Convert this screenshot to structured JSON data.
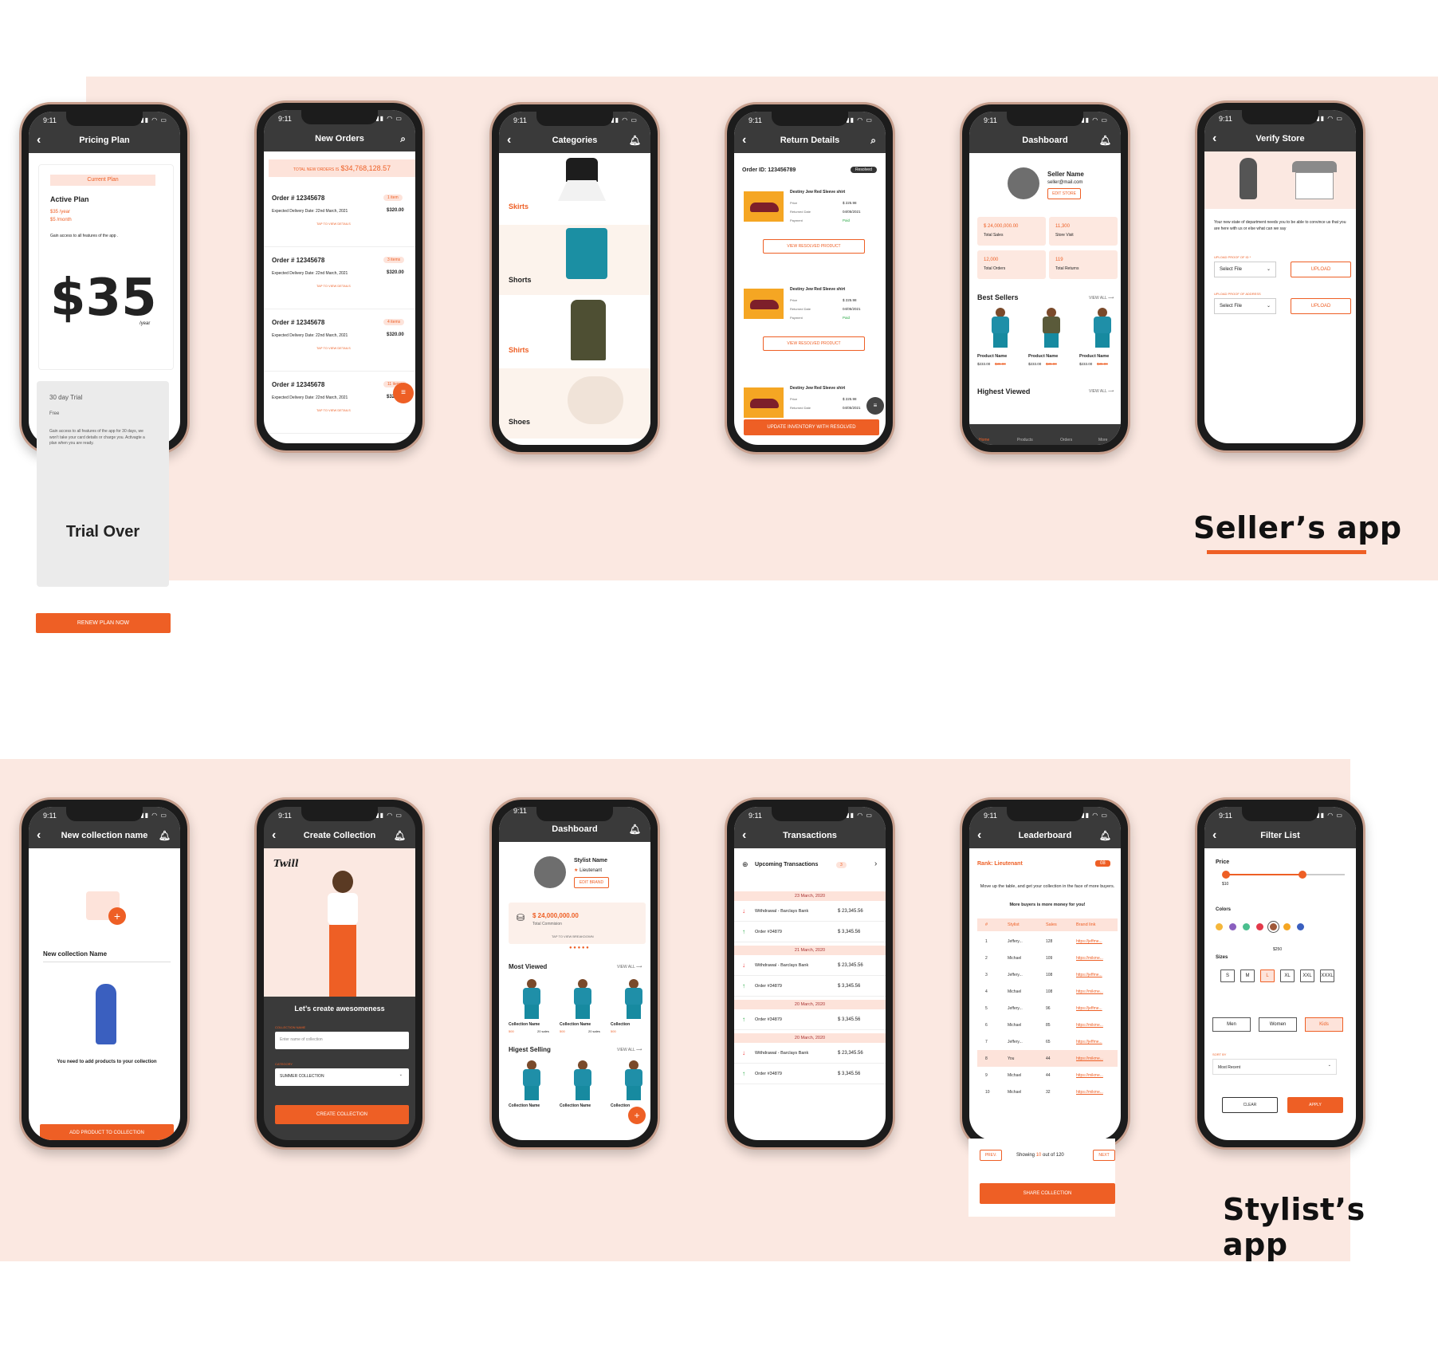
{
  "sections": {
    "seller": "Seller’s app",
    "stylist": "Stylist’s app"
  },
  "status": {
    "time": "9:11",
    "signal": "▮▮ ◠ ▭"
  },
  "colors": {
    "accent": "#ee5f25",
    "band": "#fbe8e1",
    "header": "#3a3a3a"
  },
  "pricing": {
    "title": "Pricing Plan",
    "current": "Current Plan",
    "active": "Active Plan",
    "year": "$35 /year",
    "month": "$5 /month",
    "gain": "Gain access to all features of the app .",
    "price": "$35",
    "per": "/year",
    "trial_title": "30 day Trial",
    "free": "Free",
    "trial_desc": "Gain access to all features of the app for 30 days, we won’t take your card details or charge you. Activagte a plan when you are ready.",
    "trial_over": "Trial Over",
    "renew": "RENEW PLAN NOW"
  },
  "orders": {
    "title": "New Orders",
    "total_label": "TOTAL NEW ORDERS IS",
    "total": "$34,768,128.57",
    "items": [
      {
        "id": "Order # 12345678",
        "badge": "1 item",
        "date": "Expected Delivery Date: 22nd March, 2021",
        "amount": "$320.00",
        "tap": "TAP TO VIEW DETAILS"
      },
      {
        "id": "Order # 12345678",
        "badge": "3 items",
        "date": "Expected Delivery Date: 22nd March, 2021",
        "amount": "$320.00",
        "tap": "TAP TO VIEW DETAILS"
      },
      {
        "id": "Order # 12345678",
        "badge": "4 items",
        "date": "Expected Delivery Date: 22nd March, 2021",
        "amount": "$320.00",
        "tap": "TAP TO VIEW DETAILS"
      },
      {
        "id": "Order # 12345678",
        "badge": "11 items",
        "date": "Expected Delivery Date: 22nd March, 2021",
        "amount": "$320.00",
        "tap": "TAP TO VIEW DETAILS"
      }
    ]
  },
  "categories": {
    "title": "Categories",
    "items": [
      "Skirts",
      "Shorts",
      "Shirts",
      "Shoes"
    ]
  },
  "returns": {
    "title": "Return Details",
    "order": "Order ID: 123456789",
    "status": "Resolved",
    "product": "Destiny Jew Red Sleeve shirt",
    "price_label": "Price",
    "price": "$ 225.98",
    "ret_label": "Returned Date",
    "ret_date": "04/05/2021",
    "pay_label": "Payment",
    "paid": "Paid",
    "view": "VIEW RESOLVED PRODUCT",
    "update": "UPDATE INVENTORY WITH RESOLVED"
  },
  "dashboard": {
    "title": "Dashboard",
    "name": "Seller Name",
    "email": "seller@mail.com",
    "edit": "EDIT STORE",
    "stats": [
      {
        "v": "$ 24,000,000.00",
        "l": "Total Sales"
      },
      {
        "v": "11,300",
        "l": "Store Visit"
      },
      {
        "v": "12,000",
        "l": "Total Orders"
      },
      {
        "v": "119",
        "l": "Total Returns"
      }
    ],
    "best": "Best Sellers",
    "view_all": "VIEW ALL ⟶",
    "product": "Product Name",
    "price": "$233.00",
    "old": "$35.00",
    "highest": "Highest Viewed",
    "nav": [
      "Home",
      "Products",
      "Orders",
      "More"
    ]
  },
  "verify": {
    "title": "Verify Store",
    "text": "Your new state of department needs you to be able to convince us that you are here with us or else what can we say",
    "id_label": "UPLOAD PROOF OF ID *",
    "addr_label": "UPLOAD PROOF OF ADDRESS",
    "select": "Select File",
    "upload": "UPLOAD"
  },
  "newcol": {
    "title": "New collection name",
    "name": "New collection Name",
    "msg": "You need to add products to your collection",
    "btn": "ADD PRODUCT TO COLLECTION"
  },
  "create": {
    "title": "Create Collection",
    "brand": "Twill",
    "heading": "Let’s create awesomeness",
    "name_label": "COLLECTION NAME",
    "placeholder": "Enter name of collection",
    "cat_label": "CATEGORY",
    "cat": "SUMMER COLLECTION",
    "btn": "CREATE COLLECTION"
  },
  "sdash": {
    "title": "Dashboard",
    "name": "Stylist Name",
    "rank": "Lieutenant",
    "edit": "EDIT BRAND",
    "commission": "$ 24,000,000.00",
    "comm_label": "Total Commision",
    "tap": "TAP TO VIEW BREAKDOWN",
    "most": "Most Viewed",
    "view_all": "VIEW ALL ⟶",
    "col": "Collection Name",
    "col3": "Collection",
    "views": "500",
    "sales": "20 sales",
    "highest": "Higest Selling"
  },
  "trans": {
    "title": "Transactions",
    "upcoming": "Upcoming Transactions",
    "count": "3",
    "groups": [
      {
        "date": "23 March, 2020",
        "rows": [
          {
            "d": "Withdrawal - Barclays Bank",
            "a": "$ 23,345.56",
            "up": false
          },
          {
            "d": "Order #34879",
            "a": "$ 3,345.56",
            "up": true
          }
        ]
      },
      {
        "date": "21 March, 2020",
        "rows": [
          {
            "d": "Withdrawal - Barclays Bank",
            "a": "$ 23,345.56",
            "up": false
          },
          {
            "d": "Order #34879",
            "a": "$ 3,345.56",
            "up": true
          }
        ]
      },
      {
        "date": "20 March, 2020",
        "rows": [
          {
            "d": "Order #34879",
            "a": "$ 3,345.56",
            "up": true
          }
        ]
      },
      {
        "date": "20 March, 2020",
        "rows": [
          {
            "d": "Withdrawal - Barclays Bank",
            "a": "$ 23,345.56",
            "up": false
          },
          {
            "d": "Order #34879",
            "a": "$ 3,345.56",
            "up": true
          }
        ]
      }
    ]
  },
  "leader": {
    "title": "Leaderboard",
    "rank": "Rank: Lieutenant",
    "num": "08",
    "msg": "Move up the table, and get your collection in the face of more buyers.",
    "msg2": "More buyers is more money for you!",
    "cols": [
      "#",
      "Stylist",
      "Sales",
      "Brand link"
    ],
    "rows": [
      [
        "1",
        "Jeffery...",
        "128",
        "https://jeffme..."
      ],
      [
        "2",
        "Michael",
        "109",
        "https://mikme..."
      ],
      [
        "3",
        "Jeffery...",
        "108",
        "https://jeffme..."
      ],
      [
        "4",
        "Michael",
        "108",
        "https://mikme..."
      ],
      [
        "5",
        "Jeffery...",
        "96",
        "https://jeffme..."
      ],
      [
        "6",
        "Michael",
        "85",
        "https://mikme..."
      ],
      [
        "7",
        "Jeffery...",
        "65",
        "https://jeffme..."
      ],
      [
        "8",
        "You",
        "44",
        "https://mikme..."
      ],
      [
        "9",
        "Michael",
        "44",
        "https://mikme..."
      ],
      [
        "10",
        "Michael",
        "32",
        "https://mikme..."
      ]
    ],
    "prev": "PREV.",
    "showing": "Showing",
    "shown": "10",
    "of": "out of 120",
    "next": "NEXT",
    "share": "SHARE COLLECTION"
  },
  "filter": {
    "title": "Filter List",
    "price": "Price",
    "min": "$10",
    "max": "$250",
    "colors_label": "Colors",
    "swatches": [
      "#f5b73b",
      "#8a5fbf",
      "#4bbf8f",
      "#e3394a",
      "#a0593a",
      "#f5a623",
      "#3a5fbf"
    ],
    "sizes_label": "Sizes",
    "sizes": [
      "S",
      "M",
      "L",
      "XL",
      "XXL",
      "XXXL"
    ],
    "genders": [
      "Men",
      "Women",
      "Kids"
    ],
    "sort_label": "SORT BY",
    "sort": "Most Recent",
    "clear": "CLEAR",
    "apply": "APPLY"
  }
}
